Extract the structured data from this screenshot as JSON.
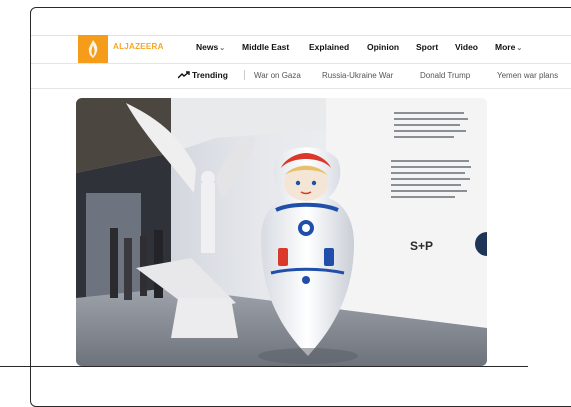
{
  "header": {
    "logo_text": "ALJAZEERA",
    "nav": [
      {
        "label": "News",
        "has_menu": true
      },
      {
        "label": "Middle East",
        "has_menu": false
      },
      {
        "label": "Explained",
        "has_menu": false
      },
      {
        "label": "Opinion",
        "has_menu": false
      },
      {
        "label": "Sport",
        "has_menu": false
      },
      {
        "label": "Video",
        "has_menu": false
      },
      {
        "label": "More",
        "has_menu": true
      }
    ]
  },
  "trending": {
    "label": "Trending",
    "items": [
      "War on Gaza",
      "Russia-Ukraine War",
      "Donald Trump",
      "Yemen war plans"
    ]
  },
  "hero": {
    "sign_text": "S+P"
  },
  "colors": {
    "brand": "#f59c1a",
    "doll_red": "#d9382b",
    "doll_blue": "#1f4fa8"
  }
}
